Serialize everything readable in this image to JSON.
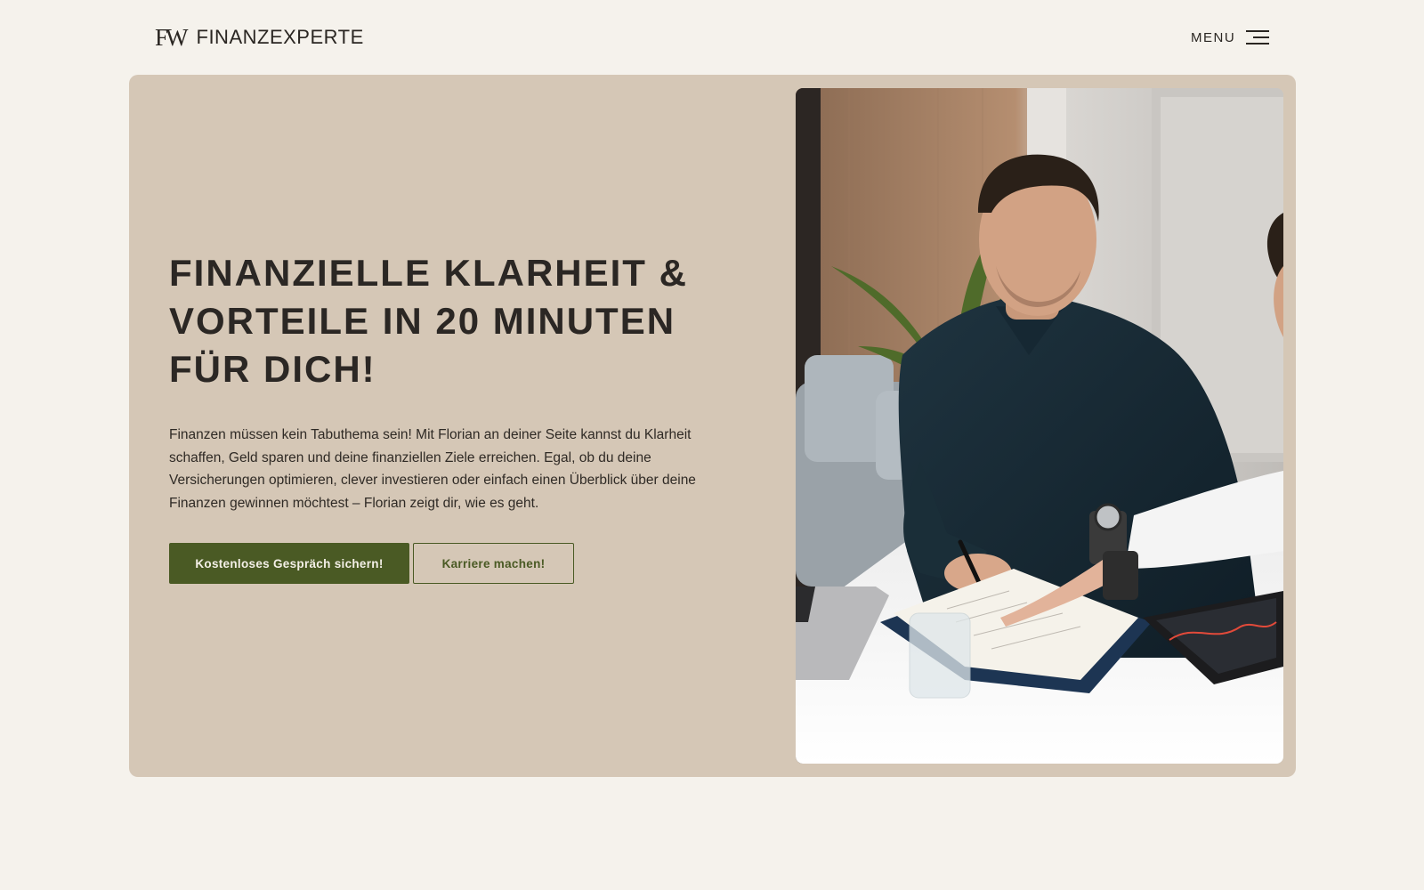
{
  "header": {
    "logo_mark": "FW",
    "logo_text": "FINANZEXPERTE",
    "menu_label": "MENU"
  },
  "hero": {
    "title": "FINANZIELLE KLARHEIT & VORTEILE IN 20 MINUTEN FÜR DICH!",
    "text": "Finanzen müssen kein Tabuthema sein! Mit Florian an deiner Seite kannst du Klarheit schaffen, Geld sparen und deine finanziellen Ziele erreichen. Egal, ob du deine Versicherungen optimieren, clever investieren oder einfach einen Überblick über deine Finanzen gewinnen möchtest – Florian zeigt dir, wie es geht.",
    "primary_button": "Kostenloses Gespräch sichern!",
    "secondary_button": "Karriere machen!"
  },
  "colors": {
    "background": "#f5f2ec",
    "hero_panel": "#d5c7b6",
    "accent_green": "#4a5a24",
    "text_dark": "#2b2724"
  }
}
